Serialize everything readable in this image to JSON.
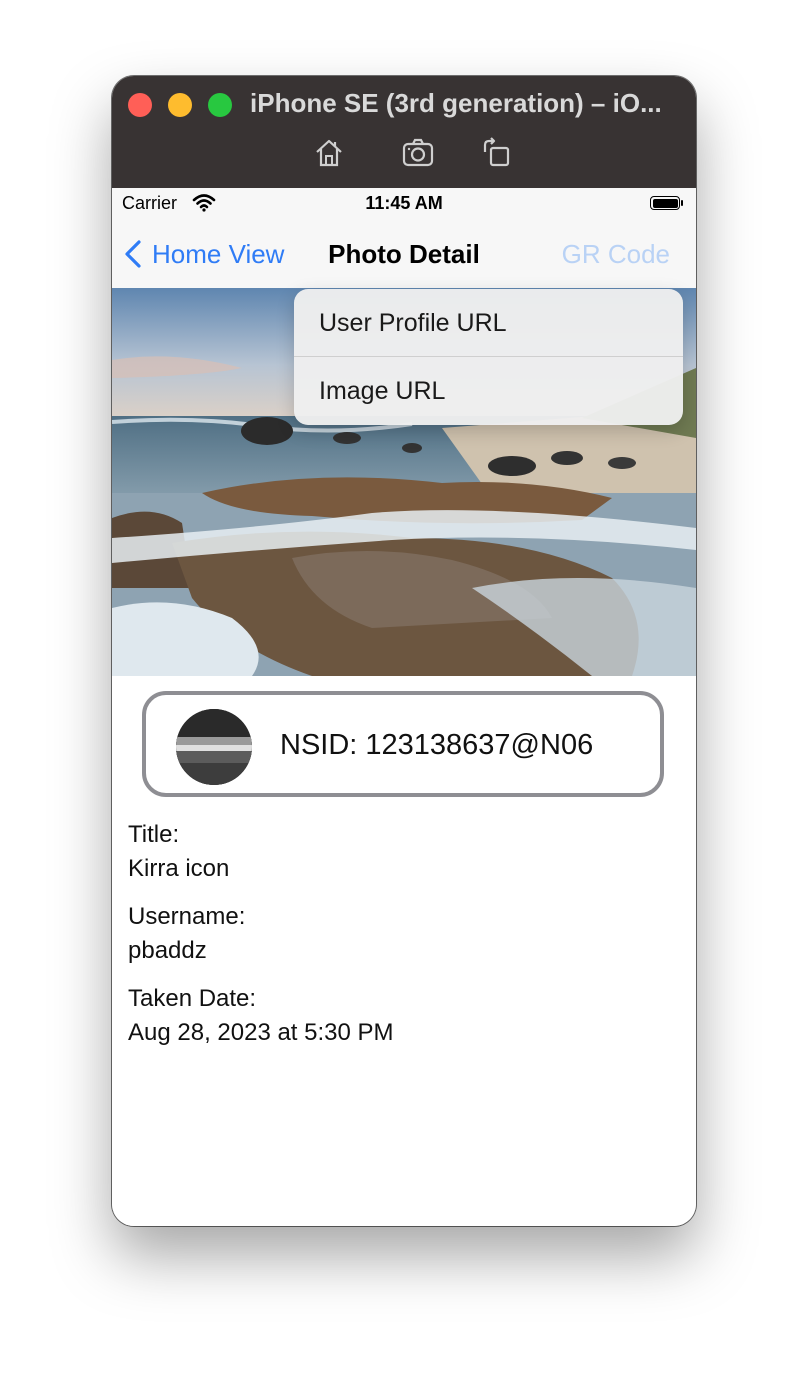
{
  "window": {
    "title": "iPhone SE (3rd generation) – iO...",
    "toolbar": [
      "home-icon",
      "screenshot-icon",
      "rotate-icon"
    ]
  },
  "status_bar": {
    "carrier": "Carrier",
    "time": "11:45 AM"
  },
  "nav": {
    "back_label": "Home View",
    "title": "Photo Detail",
    "right_label": "GR Code"
  },
  "menu": {
    "items": [
      "User Profile URL",
      "Image URL"
    ]
  },
  "owner": {
    "nsid": "NSID: 123138637@N06"
  },
  "details": {
    "title_label": "Title:",
    "title_value": "Kirra icon",
    "username_label": "Username:",
    "username_value": "pbaddz",
    "taken_label": "Taken Date:",
    "taken_value": "Aug 28, 2023 at 5:30 PM"
  },
  "colors": {
    "accent": "#2f7cf6",
    "accent_disabled": "#b9d2f5",
    "titlebar": "#383333",
    "card_border": "#8e8e93"
  }
}
